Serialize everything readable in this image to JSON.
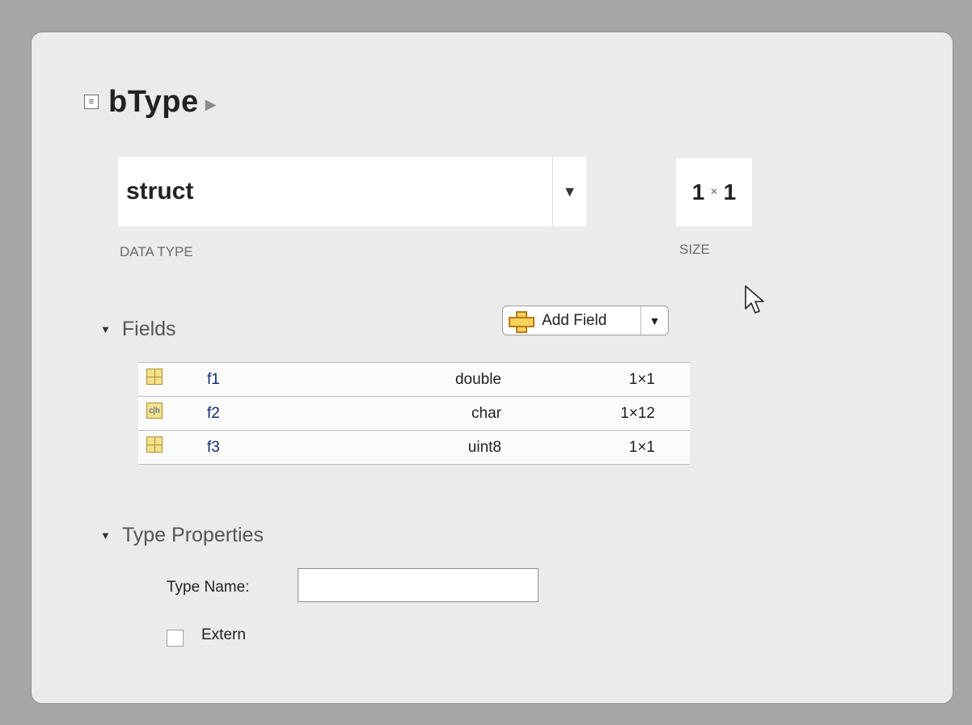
{
  "variable": {
    "name": "bType"
  },
  "data_type": {
    "value": "struct",
    "caption": "DATA TYPE"
  },
  "size": {
    "rows": "1",
    "separator": "×",
    "cols": "1",
    "caption": "SIZE"
  },
  "fields_section": {
    "label": "Fields",
    "add_button_label": "Add Field",
    "rows": [
      {
        "name": "f1",
        "type": "double",
        "size": "1×1",
        "icon": "numeric-icon"
      },
      {
        "name": "f2",
        "type": "char",
        "size": "1×12",
        "icon": "char-icon"
      },
      {
        "name": "f3",
        "type": "uint8",
        "size": "1×1",
        "icon": "numeric-icon"
      }
    ]
  },
  "type_properties": {
    "label": "Type Properties",
    "type_name_label": "Type Name:",
    "type_name_value": "",
    "extern_label": "Extern",
    "extern_checked": false
  }
}
